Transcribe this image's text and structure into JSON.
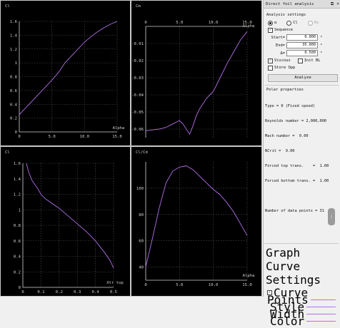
{
  "panel": {
    "title": "Direct foil analysis",
    "analysis_settings_title": "Analysis settings",
    "radio_alpha": "α",
    "radio_cl": "Cl",
    "radio_re": "Re",
    "sequence_label": "Sequence",
    "start_label": "Start=",
    "start_value": "0.000",
    "end_label": "End=",
    "end_value": "35.000",
    "delta_label": "Δ=",
    "delta_value": "0.500",
    "unit": "°",
    "viscous_label": "Viscous",
    "init_bl_label": "Init BL",
    "store_opp_label": "Store Opp",
    "analyze_label": "Analyze",
    "polar_title": "Polar properties",
    "polar_lines": [
      "Type = 0 (Fixed speed)",
      "Reynolds number = 2,000,000",
      "Mach number =  0.00",
      "NCrit =  9.00",
      "Forced top trans.    =  1.00",
      "Forced bottom trans. =  1.00",
      "",
      "Number of data points = 31"
    ]
  },
  "graph_curve": {
    "title": "Graph Curve Settings",
    "curve_label": "Curve",
    "points_label": "Points",
    "style_label": "Style",
    "width_label": "Width",
    "color_label": "Color"
  },
  "colors": {
    "curve": "#b36fe8",
    "plot_bg": "#000000",
    "axis": "#d0d0d0",
    "grid": "#555555"
  },
  "chart_data": [
    {
      "type": "line",
      "title": "Cl",
      "xlabel": "Alpha",
      "ylabel": "",
      "xlim": [
        0,
        15
      ],
      "ylim": [
        0,
        1.6
      ],
      "xticks": [
        "0",
        "5.0",
        "10.0",
        "15.0"
      ],
      "yticks": [
        "0",
        "0.2",
        "0.4",
        "0.6",
        "0.8",
        "1",
        "1.2",
        "1.4",
        "1.6"
      ],
      "x": [
        0,
        1,
        2,
        3,
        4,
        5,
        6,
        7,
        8,
        9,
        10,
        11,
        12,
        13,
        14,
        15
      ],
      "series": [
        {
          "values": [
            0.25,
            0.35,
            0.45,
            0.55,
            0.65,
            0.75,
            0.86,
            1.0,
            1.1,
            1.2,
            1.3,
            1.38,
            1.45,
            1.51,
            1.56,
            1.6
          ]
        }
      ]
    },
    {
      "type": "line",
      "title": "Cm",
      "xlabel": "Alpha",
      "ylabel": "",
      "xlim": [
        0,
        15
      ],
      "ylim": [
        -0.065,
        0
      ],
      "xticks": [
        "0",
        "5.0",
        "10.0",
        "15.0"
      ],
      "yticks": [
        "-0.01",
        "-0.02",
        "-0.03",
        "-0.04",
        "-0.05",
        "-0.06"
      ],
      "x": [
        0,
        1,
        2,
        3,
        4,
        5,
        5.5,
        6,
        6.5,
        7,
        7.5,
        8,
        9,
        10,
        11,
        12,
        13,
        14,
        15
      ],
      "series": [
        {
          "values": [
            -0.061,
            -0.0605,
            -0.06,
            -0.059,
            -0.057,
            -0.055,
            -0.057,
            -0.06,
            -0.063,
            -0.058,
            -0.052,
            -0.048,
            -0.042,
            -0.038,
            -0.03,
            -0.022,
            -0.015,
            -0.008,
            -0.003
          ]
        }
      ]
    },
    {
      "type": "line",
      "title": "Cl",
      "xlabel": "Xtr top",
      "ylabel": "",
      "xlim": [
        0,
        0.5
      ],
      "ylim": [
        0,
        1.6
      ],
      "xticks": [
        "0",
        "0.1",
        "0.2",
        "0.3",
        "0.4",
        "0.5"
      ],
      "yticks": [
        "0",
        "0.2",
        "0.4",
        "0.6",
        "0.8",
        "1",
        "1.2",
        "1.4",
        "1.6"
      ],
      "x": [
        0.02,
        0.03,
        0.05,
        0.08,
        0.1,
        0.12,
        0.15,
        0.2,
        0.25,
        0.3,
        0.35,
        0.4,
        0.45,
        0.48,
        0.5
      ],
      "series": [
        {
          "values": [
            1.6,
            1.5,
            1.38,
            1.28,
            1.2,
            1.15,
            1.1,
            1.02,
            0.92,
            0.82,
            0.72,
            0.6,
            0.45,
            0.35,
            0.25
          ]
        }
      ]
    },
    {
      "type": "line",
      "title": "Cl/Cd",
      "xlabel": "Alpha",
      "ylabel": "",
      "xlim": [
        0,
        15
      ],
      "ylim": [
        30,
        120
      ],
      "xticks": [
        "0",
        "5.0",
        "10.0",
        "15.0"
      ],
      "yticks": [
        "40",
        "60",
        "80",
        "100"
      ],
      "x": [
        0,
        1,
        2,
        3,
        4,
        5,
        6,
        7,
        8,
        9,
        10,
        11,
        12,
        13,
        14,
        15
      ],
      "series": [
        {
          "values": [
            40,
            62,
            85,
            104,
            113,
            116,
            117,
            114,
            109,
            104,
            99,
            95,
            89,
            82,
            73,
            64
          ]
        }
      ]
    }
  ]
}
